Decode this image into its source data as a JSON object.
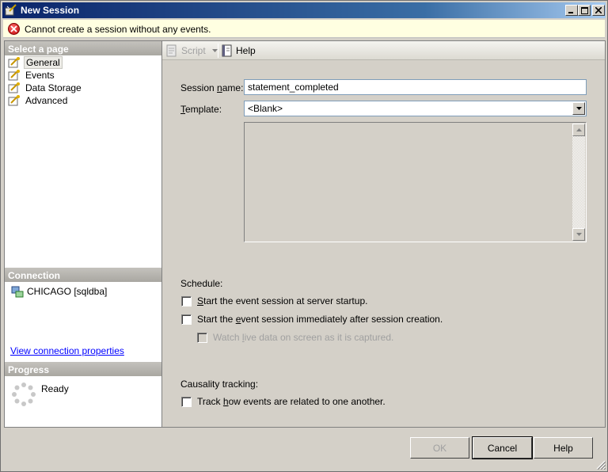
{
  "window": {
    "title": "New Session"
  },
  "error": {
    "message": "Cannot create a session without any events."
  },
  "sidebar": {
    "select_page_header": "Select a page",
    "pages": [
      {
        "label": "General",
        "selected": true
      },
      {
        "label": "Events"
      },
      {
        "label": "Data Storage"
      },
      {
        "label": "Advanced"
      }
    ],
    "connection_header": "Connection",
    "connection_server": "CHICAGO [sqldba]",
    "view_connection_link": "View connection properties",
    "progress_header": "Progress",
    "progress_status": "Ready"
  },
  "toolbar": {
    "script_label": "Script",
    "help_label": "Help"
  },
  "form": {
    "session_name_label_pre": "Session ",
    "session_name_label_u": "n",
    "session_name_label_post": "ame:",
    "session_name_value": "statement_completed",
    "template_label_u": "T",
    "template_label_post": "emplate:",
    "template_value": "<Blank>",
    "schedule_label": "Schedule:",
    "schedule_options": [
      {
        "pre": "",
        "u": "S",
        "post": "tart the event session at server startup.",
        "checked": false
      },
      {
        "pre": "Start the ",
        "u": "e",
        "post": "vent session immediately after session creation.",
        "checked": false
      },
      {
        "pre": "Watch ",
        "u": "l",
        "post": "ive data on screen as it is captured.",
        "checked": false,
        "disabled": true
      }
    ],
    "causality_label": "Causality tracking:",
    "causality_option": {
      "pre": "Track ",
      "u": "h",
      "post": "ow events are related to one another.",
      "checked": false
    }
  },
  "buttons": {
    "ok": "OK",
    "cancel": "Cancel",
    "help": "Help"
  }
}
